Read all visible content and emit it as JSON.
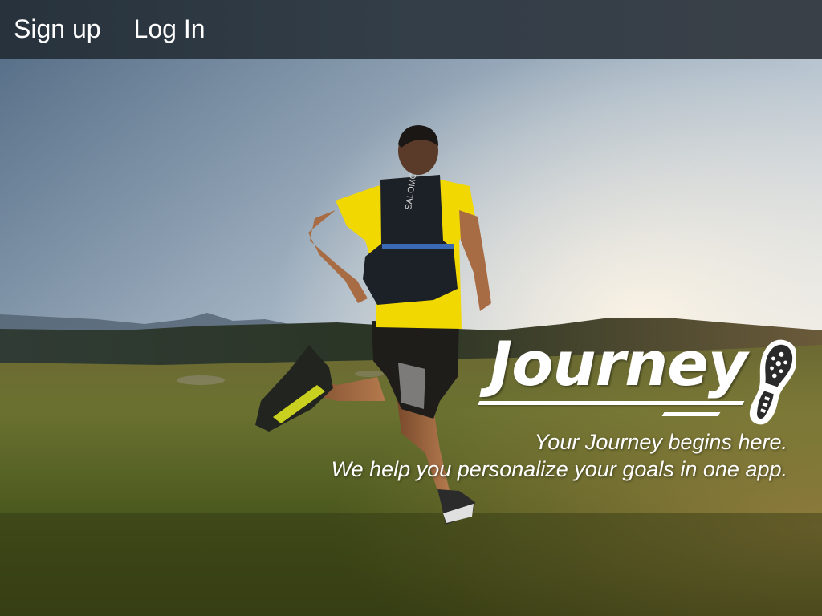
{
  "nav": {
    "signup_label": "Sign up",
    "login_label": "Log In"
  },
  "hero": {
    "image": "trail-runner-photo",
    "brand_name": "Journey",
    "brand_icon": "shoe-sole-icon",
    "tagline_line1": "Your Journey begins here.",
    "tagline_line2": "We help you personalize your goals in one app."
  },
  "colors": {
    "topbar": "#333e48",
    "text": "#ffffff",
    "shirt": "#f0d800",
    "grass": "#4f5a1e"
  }
}
